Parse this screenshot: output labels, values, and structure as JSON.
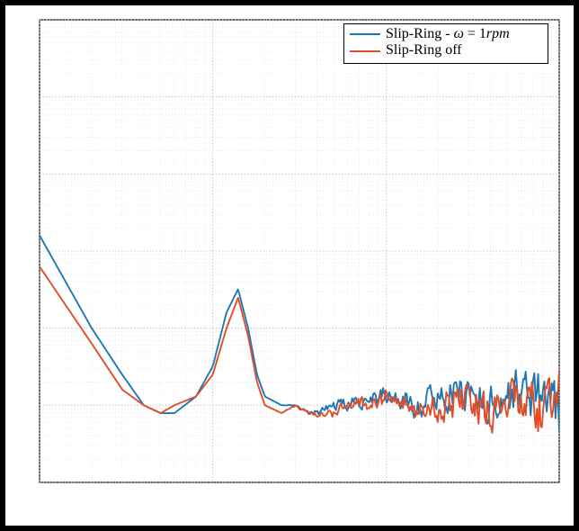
{
  "chart_data": {
    "type": "line",
    "xscale": "log",
    "yscale": "log",
    "xlabel": "",
    "ylabel": "",
    "title": "",
    "xlim": [
      1,
      1000
    ],
    "ylim": [
      1e-09,
      0.001
    ],
    "legend": {
      "position": "upper-right",
      "entries": [
        {
          "name": "Slip-Ring - ω = 1 rpm",
          "color": "#1f78b4"
        },
        {
          "name": "Slip-Ring off",
          "color": "#e04e29"
        }
      ]
    },
    "series": [
      {
        "name": "Slip-Ring - ω = 1 rpm",
        "color": "#1f78b4",
        "x": [
          1,
          2,
          3,
          4,
          5,
          6,
          8,
          10,
          12,
          14,
          16,
          18,
          20,
          25,
          30,
          35,
          40,
          50,
          60,
          80,
          100,
          150,
          200,
          300,
          400,
          600,
          800,
          1000
        ],
        "y": [
          1.6e-06,
          1e-07,
          2.5e-08,
          1e-08,
          7.9e-09,
          7.9e-09,
          1.3e-08,
          3.2e-08,
          1.6e-07,
          3.2e-07,
          1e-07,
          2.5e-08,
          1.3e-08,
          1e-08,
          1e-08,
          7.9e-09,
          7.9e-09,
          1e-08,
          1e-08,
          1.3e-08,
          1.3e-08,
          1e-08,
          1.3e-08,
          1.6e-08,
          1e-08,
          1.6e-08,
          1.3e-08,
          7.9e-09
        ]
      },
      {
        "name": "Slip-Ring off",
        "color": "#e04e29",
        "x": [
          1,
          2,
          3,
          4,
          5,
          6,
          8,
          10,
          12,
          14,
          16,
          18,
          20,
          25,
          30,
          35,
          40,
          50,
          60,
          80,
          100,
          150,
          200,
          300,
          400,
          600,
          800,
          1000
        ],
        "y": [
          6.3e-07,
          6.3e-08,
          1.6e-08,
          1e-08,
          7.9e-09,
          1e-08,
          1.3e-08,
          2.5e-08,
          1e-07,
          2.5e-07,
          7.9e-08,
          2e-08,
          1e-08,
          7.9e-09,
          1e-08,
          7.9e-09,
          7.9e-09,
          7.9e-09,
          1e-08,
          1e-08,
          1.3e-08,
          1e-08,
          1e-08,
          1.3e-08,
          7.9e-09,
          1.3e-08,
          7.9e-09,
          1.6e-08
        ]
      }
    ]
  },
  "legend_label_1_prefix": "Slip-Ring - ",
  "legend_label_1_eq": "ω = 1",
  "legend_label_1_unit": "rpm",
  "legend_label_2": "Slip-Ring off"
}
